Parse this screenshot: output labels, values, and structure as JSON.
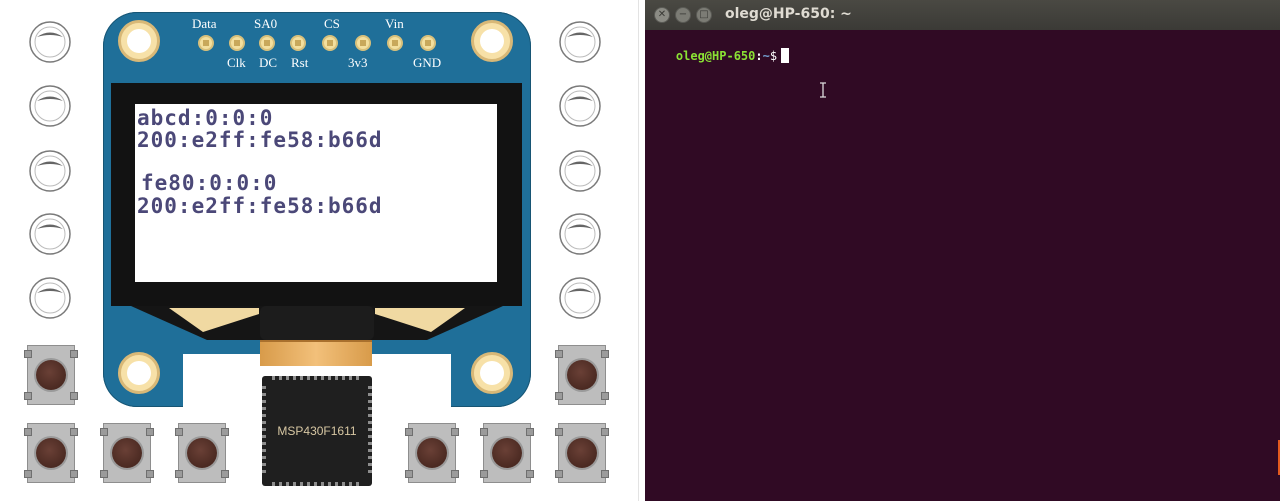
{
  "simulator": {
    "pins": [
      "Data",
      "Clk",
      "SA0",
      "DC",
      "Rst",
      "CS",
      "3v3",
      "Vin",
      "GND"
    ],
    "oled_lines": [
      "abcd:0:0:0",
      "200:e2ff:fe58:b66d",
      "fe80:0:0:0",
      "200:e2ff:fe58:b66d"
    ],
    "chip_label": "MSP430F1611",
    "knob_count": 10,
    "button_count": 8
  },
  "terminal": {
    "title": "oleg@HP-650: ~",
    "prompt_user": "oleg@HP-650",
    "prompt_sep": ":",
    "prompt_path": "~",
    "prompt_symbol": "$",
    "input": "",
    "colors": {
      "background": "#300a24",
      "user": "#8ae234",
      "path": "#729fcf"
    }
  },
  "icons": {
    "close": "close-icon",
    "minimize": "minimize-icon",
    "maximize": "maximize-icon",
    "text_cursor": "text-cursor-icon"
  }
}
